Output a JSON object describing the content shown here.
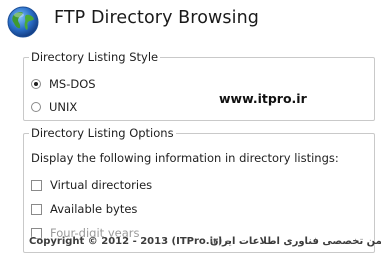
{
  "header": {
    "title": "FTP Directory Browsing",
    "icon": "globe-icon"
  },
  "listing_style": {
    "legend": "Directory Listing Style",
    "options": [
      {
        "label": "MS-DOS",
        "selected": true
      },
      {
        "label": "UNIX",
        "selected": false
      }
    ]
  },
  "listing_options": {
    "legend": "Directory Listing Options",
    "description": "Display the following information in directory listings:",
    "checkboxes": [
      {
        "label": "Virtual directories",
        "checked": false
      },
      {
        "label": "Available bytes",
        "checked": false
      },
      {
        "label": "Four-digit years",
        "checked": false
      }
    ]
  },
  "watermark": {
    "site": "www.itpro.ir",
    "copyright": "Copyright © 2012 - 2013 (ITPro.ir) -",
    "persian": "انجمن تخصصی فناوری اطلاعات ایران"
  },
  "colors": {
    "border": "#c9c9c9",
    "globe_blue": "#2a6fc9",
    "globe_green": "#3f9a2f"
  }
}
